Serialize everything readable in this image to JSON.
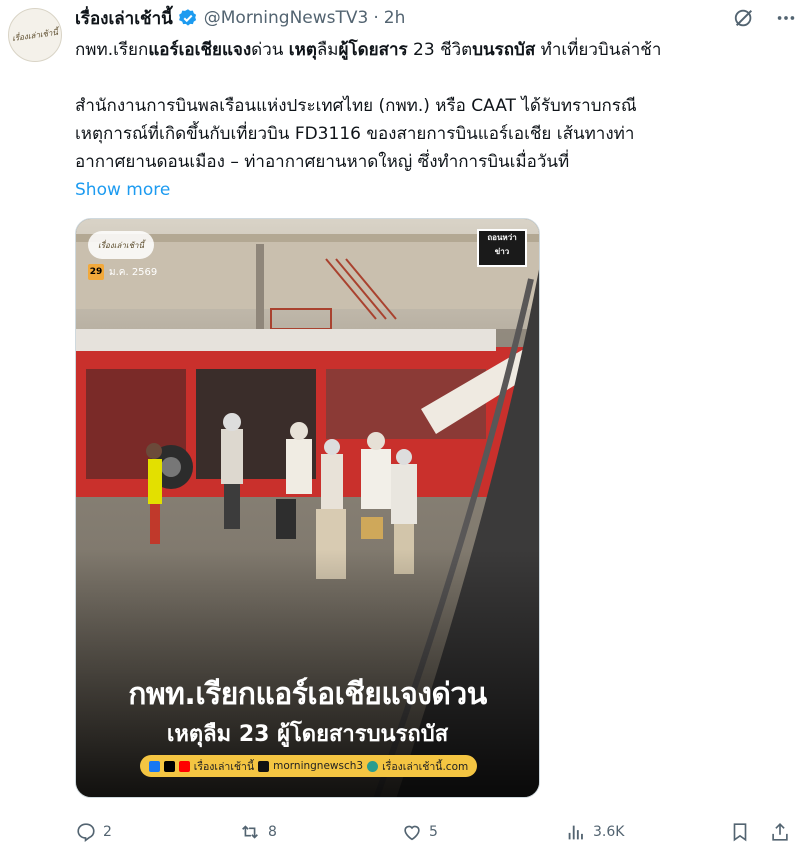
{
  "author": {
    "name": "เรื่องเล่าเช้านี้",
    "handle": "@MorningNewsTV3",
    "separator": "·",
    "time": "2h",
    "avatar_icon": "morning-news-logo"
  },
  "colors": {
    "accent": "#1d9bf0",
    "secondary_text": "#536471",
    "text": "#0f1419"
  },
  "tweet": {
    "line1": {
      "p1": "กพท.เรียก",
      "b1": "แอร์เอเชียแจง",
      "p2": "ด่วน ",
      "b2": "เหตุ",
      "p3": "ลืม",
      "b3": "ผู้โดยสาร",
      "p4": " 23 ชีวิต",
      "b4": "บนรถบัส",
      "p5": " ทำเที่ยวบินล่าช้า"
    },
    "body_l1": "สำนักงานการบินพลเรือนแห่งประเทศไทย (กพท.) หรือ CAAT ได้รับทราบกรณี",
    "body_l2": "เหตุการณ์ที่เกิดขึ้นกับเที่ยวบิน FD3116 ของสายการบินแอร์เอเชีย เส้นทางท่า",
    "body_l3": "อากาศยานดอนเมือง – ท่าอากาศยานหาดใหญ่ ซึ่งทำการบินเมื่อวันที่",
    "show_more": "Show more"
  },
  "media": {
    "date_day": "29",
    "date_rest": "ม.ค. 2569",
    "title_line1": "กพท.เรียกแอร์เอเชียแจงด่วน",
    "title_line2": "เหตุลืม  23  ผู้โดยสารบนรถบัส",
    "social_name": "เรื่องเล่าเช้านี้",
    "social_tiktok": "morningnewsch3",
    "social_web": "เรื่องเล่าเช้านี้.com",
    "badge_l1": "ถอนหว่า",
    "badge_l2": "ข่าว"
  },
  "actions": {
    "replies": "2",
    "reposts": "8",
    "likes": "5",
    "views": "3.6K"
  }
}
